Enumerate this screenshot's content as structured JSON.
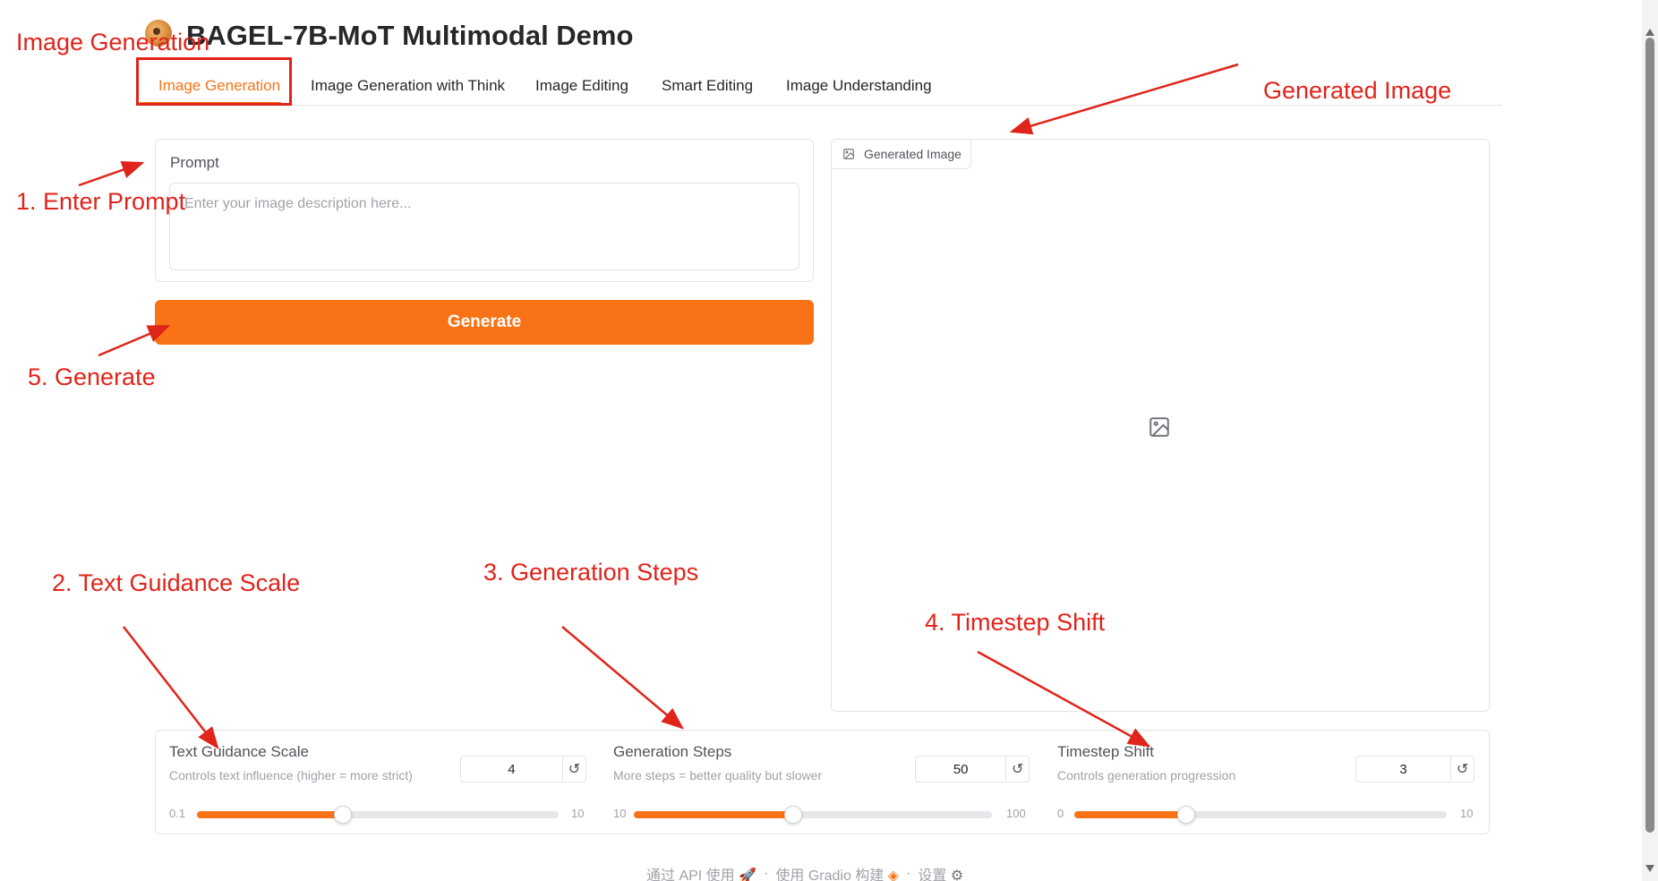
{
  "header": {
    "title": "BAGEL-7B-MoT Multimodal Demo",
    "logo_icon": "bagel-logo-icon"
  },
  "tabs": [
    {
      "label": "Image Generation",
      "active": true
    },
    {
      "label": "Image Generation with Think",
      "active": false
    },
    {
      "label": "Image Editing",
      "active": false
    },
    {
      "label": "Smart Editing",
      "active": false
    },
    {
      "label": "Image Understanding",
      "active": false
    }
  ],
  "prompt": {
    "label": "Prompt",
    "placeholder": "Enter your image description here...",
    "value": ""
  },
  "generate_button": {
    "label": "Generate"
  },
  "output": {
    "label": "Generated Image",
    "icon": "image-icon"
  },
  "sliders": [
    {
      "label": "Text Guidance Scale",
      "info": "Controls text influence (higher = more strict)",
      "value": "4",
      "min": "0.1",
      "max": "10",
      "fraction": 0.404
    },
    {
      "label": "Generation Steps",
      "info": "More steps = better quality but slower",
      "value": "50",
      "min": "10",
      "max": "100",
      "fraction": 0.444
    },
    {
      "label": "Timestep Shift",
      "info": "Controls generation progression",
      "value": "3",
      "min": "0",
      "max": "10",
      "fraction": 0.3
    }
  ],
  "footer": {
    "api": "通过 API 使用",
    "built": "使用 Gradio 构建",
    "settings": "设置",
    "separator": "·"
  },
  "annotations": {
    "tab": "Image Generation",
    "prompt": "1. Enter Prompt",
    "guidance": "2. Text Guidance Scale",
    "steps": "3. Generation Steps",
    "shift": "4. Timestep Shift",
    "generate": "5. Generate",
    "output": "Generated Image"
  },
  "colors": {
    "accent": "#f97316",
    "annotation": "#e0241b"
  }
}
